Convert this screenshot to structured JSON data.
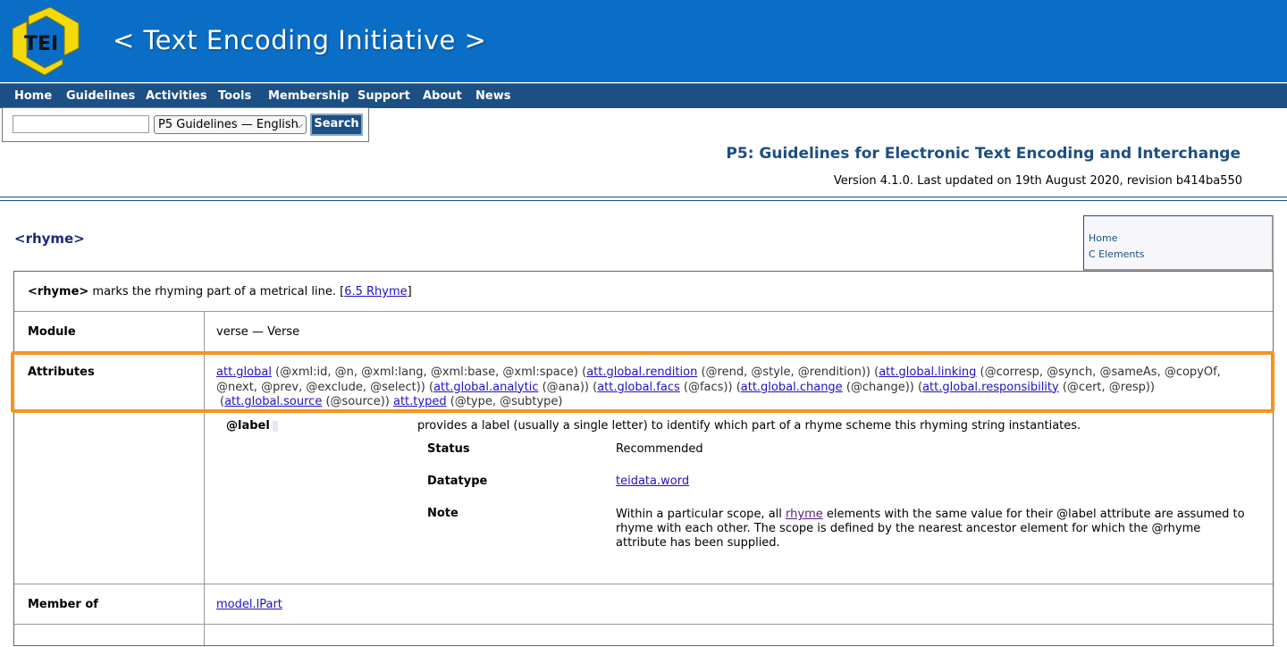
{
  "header": {
    "logo_text": "TEI",
    "site_title": "< Text Encoding Initiative >"
  },
  "nav": {
    "items": [
      "Home",
      "Guidelines",
      "Activities",
      "Tools",
      "Membership",
      "Support",
      "About",
      "News"
    ]
  },
  "search": {
    "input_value": "",
    "select_value": "P5 Guidelines — English",
    "button_label": "Search"
  },
  "guidelines": {
    "title": "P5: Guidelines for Electronic Text Encoding and Interchange",
    "version_line": "Version 4.1.0. Last updated on 19th August 2020, revision b414ba550"
  },
  "element": {
    "title": "<rhyme>"
  },
  "side_nav": {
    "links": [
      "Home",
      "C Elements"
    ]
  },
  "spec": {
    "summary_element": "<rhyme>",
    "summary_text": " marks the rhyming part of a metrical line. [",
    "summary_link": "6.5 Rhyme",
    "summary_close": "]",
    "module_label": "Module",
    "module_value": "verse — Verse",
    "attributes_label": "Attributes",
    "attributes_line1": [
      {
        "t": "att.global",
        "link": true
      },
      {
        "t": " (@xml:id, @n, @xml:lang, @xml:base, @xml:space) (",
        "link": false
      },
      {
        "t": "att.global.rendition",
        "link": true
      },
      {
        "t": " (@rend, @style, @rendition)) (",
        "link": false
      },
      {
        "t": "att.global.linking",
        "link": true
      },
      {
        "t": " (@corresp, @synch, @sameAs, @copyOf,",
        "link": false
      }
    ],
    "attributes_line2": [
      {
        "t": "@next, @prev, @exclude, @select)) (",
        "link": false
      },
      {
        "t": "att.global.analytic",
        "link": true
      },
      {
        "t": " (@ana)) (",
        "link": false
      },
      {
        "t": "att.global.facs",
        "link": true
      },
      {
        "t": " (@facs)) (",
        "link": false
      },
      {
        "t": "att.global.change",
        "link": true
      },
      {
        "t": " (@change)) (",
        "link": false
      },
      {
        "t": "att.global.responsibility",
        "link": true
      },
      {
        "t": " (@cert, @resp))",
        "link": false
      }
    ],
    "attributes_line3": [
      {
        "t": "(",
        "link": false
      },
      {
        "t": "att.global.source",
        "link": true
      },
      {
        "t": " (@source)) ",
        "link": false
      },
      {
        "t": "att.typed",
        "link": true
      },
      {
        "t": " (@type, @subtype)",
        "link": false
      }
    ],
    "attr_label_name": "@label",
    "attr_label_desc": "provides a label (usually a single letter) to identify which part of a rhyme scheme this rhyming string instantiates.",
    "status_label": "Status",
    "status_value": "Recommended",
    "datatype_label": "Datatype",
    "datatype_value": "teidata.word",
    "note_label": "Note",
    "note_before": "Within a particular scope, all ",
    "note_link": "rhyme",
    "note_after": " elements with the same value for their @label attribute are assumed to rhyme with each other. The scope is defined by the nearest ancestor element for which the @rhyme attribute has been supplied.",
    "member_label": "Member of",
    "member_value": "model.lPart"
  },
  "colors": {
    "banner": "#0a6ec6",
    "nav": "#1c4f84",
    "highlight": "#f7931e",
    "logo_yellow": "#f5d90a"
  }
}
